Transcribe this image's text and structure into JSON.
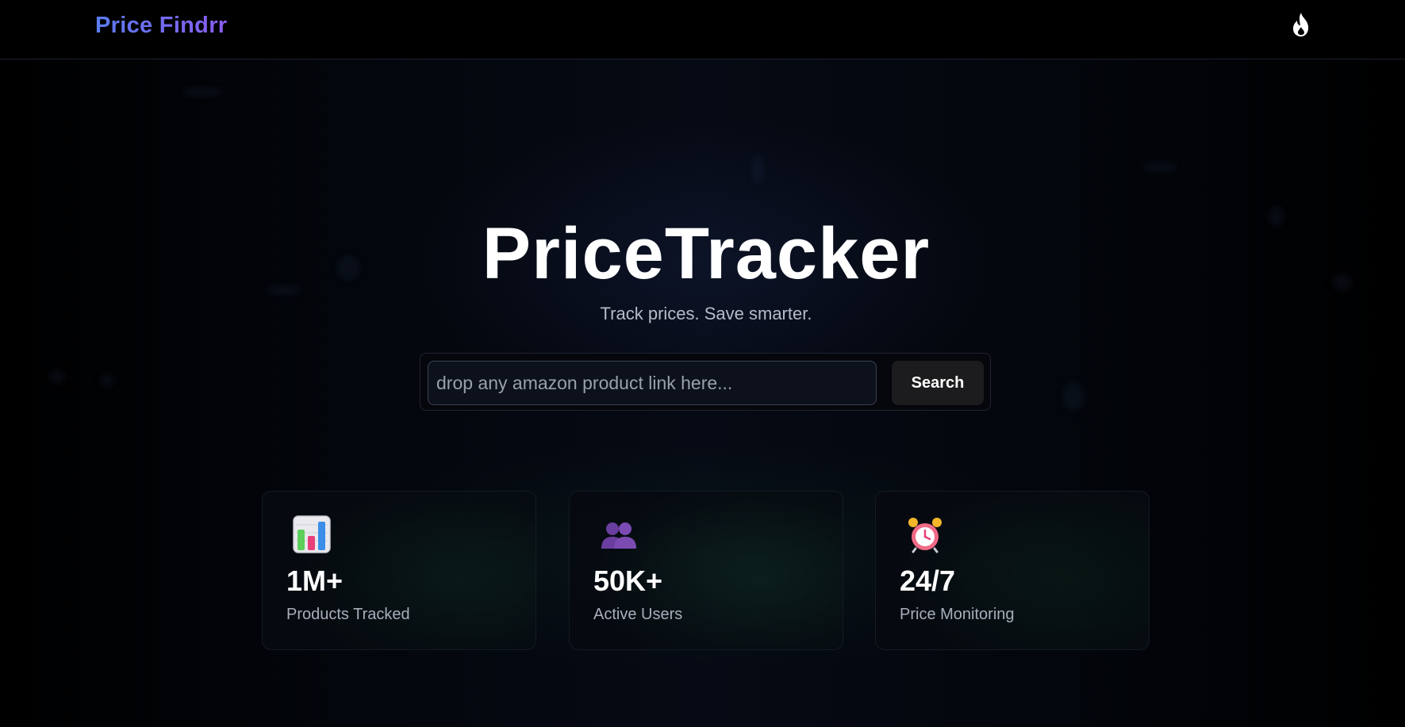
{
  "navbar": {
    "brand": "Price Findrr",
    "theme_toggle_icon": "flame-icon"
  },
  "hero": {
    "title": "PriceTracker",
    "subtitle": "Track prices. Save smarter."
  },
  "search": {
    "placeholder": "drop any amazon product link here...",
    "value": "",
    "button_label": "Search"
  },
  "stats": [
    {
      "icon": "bar-chart-icon",
      "value": "1M+",
      "label": "Products Tracked"
    },
    {
      "icon": "users-icon",
      "value": "50K+",
      "label": "Active Users"
    },
    {
      "icon": "alarm-clock-icon",
      "value": "24/7",
      "label": "Price Monitoring"
    }
  ],
  "colors": {
    "background": "#000000",
    "brand_gradient_start": "#5a7cf0",
    "brand_gradient_end": "#8a5cf0",
    "accent_green": "#143c28"
  }
}
